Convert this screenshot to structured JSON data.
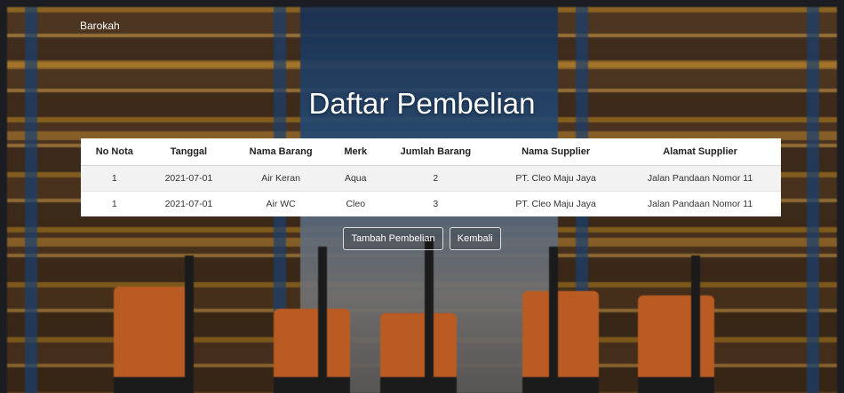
{
  "navbar": {
    "brand": "Barokah"
  },
  "page": {
    "title": "Daftar Pembelian"
  },
  "table": {
    "headers": [
      "No Nota",
      "Tanggal",
      "Nama Barang",
      "Merk",
      "Jumlah Barang",
      "Nama Supplier",
      "Alamat Supplier"
    ],
    "rows": [
      [
        "1",
        "2021-07-01",
        "Air Keran",
        "Aqua",
        "2",
        "PT. Cleo Maju Jaya",
        "Jalan Pandaan Nomor 11"
      ],
      [
        "1",
        "2021-07-01",
        "Air WC",
        "Cleo",
        "3",
        "PT. Cleo Maju Jaya",
        "Jalan Pandaan Nomor 11"
      ]
    ]
  },
  "actions": {
    "add_label": "Tambah Pembelian",
    "back_label": "Kembali"
  },
  "colors": {
    "accent_orange": "#e2702a",
    "table_bg": "#ffffff"
  }
}
